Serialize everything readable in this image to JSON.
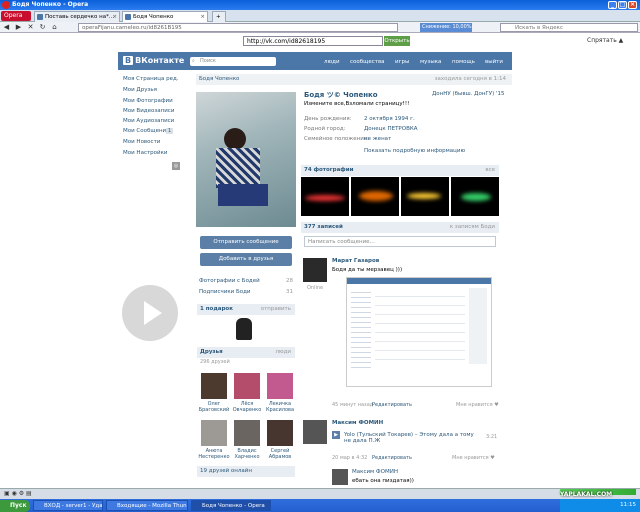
{
  "window": {
    "title": "Бодя Чопенко - Opera"
  },
  "tabs": [
    {
      "label": "Opera"
    },
    {
      "label": "Поставь сердечко на*..."
    },
    {
      "label": "Бодя Чопенко"
    }
  ],
  "addressbar": {
    "url": "operaFijanu.cameleo.ru/id8261B195",
    "security": "Снижение: 10,00%",
    "search_placeholder": "Искать в Яндекс"
  },
  "proxy": {
    "url": "http://vk.com/id82618195",
    "go_label": "Открыть",
    "hide_label": "Спрятать"
  },
  "vk": {
    "logo": "ВКонтакте",
    "search_placeholder": "Поиск",
    "topnav": [
      "люди",
      "сообщества",
      "игры",
      "музыка",
      "помощь",
      "выйти"
    ],
    "menu": [
      "Моя Страница  ред.",
      "Мои Друзья",
      "Мои Фотографии",
      "Мои Видеозаписи",
      "Мои Аудиозаписи",
      "Мои Сообщения",
      "Мои Новости",
      "Мои Настройки"
    ],
    "menu_messages_badge": "1",
    "header": {
      "name": "Бодя Чопенко",
      "last_seen": "заходила сегодня в 1:14"
    },
    "profile": {
      "name": "Бодя ツ© Чопенко",
      "school": "ДонНУ (бывш. ДонГУ) '15",
      "status": "Измените все,Взломали страницу!!!",
      "birthday_label": "День рождения:",
      "birthday": "2 октября 1994 г.",
      "city_label": "Родной город:",
      "city": "Донецк ПЕТРОВКА",
      "family_label": "Семейное положение:",
      "family": "не женат",
      "more": "Показать подробную информацию"
    },
    "buttons": {
      "send": "Отправить сообщение",
      "add": "Добавить в друзья"
    },
    "left_links": [
      {
        "label": "Фотографии с Бодей",
        "count": "28"
      },
      {
        "label": "Подписчики Боди",
        "count": "31"
      }
    ],
    "gifts": {
      "title": "1 подарок",
      "action": "отправить"
    },
    "friends": {
      "title": "Друзья",
      "action": "люди",
      "count": "296 друзей",
      "list": [
        {
          "first": "Олег",
          "last": "Браговский"
        },
        {
          "first": "Лёся",
          "last": "Овчаренко"
        },
        {
          "first": "Лекичка",
          "last": "Красилова"
        },
        {
          "first": "Анюта",
          "last": "Нестеренко"
        },
        {
          "first": "Владис",
          "last": "Харченко"
        },
        {
          "first": "Сергей",
          "last": "Абрамов"
        }
      ],
      "online": "19 друзей онлайн"
    },
    "photos": {
      "title": "74 фотографии",
      "action": "все"
    },
    "wall": {
      "title": "377 записей",
      "action": "к записям Боди",
      "placeholder": "Написать сообщение..."
    },
    "posts": [
      {
        "author": "Марат Газаров",
        "text": "Бодя да ты мерзавец )))",
        "status": "Online",
        "date": "45 минут назад",
        "reply": "Редактировать",
        "like": "Мне нравится"
      },
      {
        "author": "Максим ФОМИН",
        "audio": "Yolo (Тульский Токарев) – Этому дала а тому не дала П.Ж",
        "duration": "3:21",
        "date": "20 мар в 4:32",
        "reply": "Редактировать",
        "like": "Мне нравится"
      }
    ],
    "comment": {
      "author": "Максим ФОМИН",
      "text": "ебать она пиздатая))"
    }
  },
  "taskbar": {
    "start": "Пуск",
    "tasks": [
      "ВХОД - server1 - Удале...",
      "Входящие - Mozilla Thun...",
      "Бодя Чопенко - Opera"
    ],
    "clock": "11:15",
    "watermark": "YAPLAKAL.COM"
  },
  "colors": {
    "vk_blue": "#4a76a8",
    "vk_link": "#2b587a",
    "title_blue": "#0a5fd8",
    "taskbar_blue": "#245fd0"
  }
}
